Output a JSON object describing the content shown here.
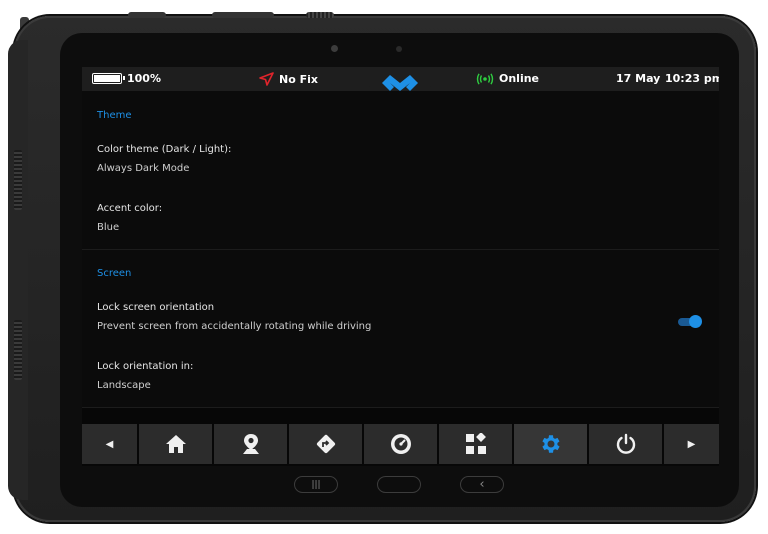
{
  "status_bar": {
    "battery_percent_label": "100%",
    "battery_level": 1.0,
    "gps_label": "No Fix",
    "connection_label": "Online",
    "date": "17 May",
    "time": "10:23 pm",
    "colors": {
      "gps_icon": "#e0242b",
      "online_icon": "#2ecc40"
    }
  },
  "theme_section": {
    "title": "Theme",
    "color_theme_label": "Color theme (Dark / Light):",
    "color_theme_value": "Always Dark Mode",
    "accent_color_label": "Accent color:",
    "accent_color_value": "Blue"
  },
  "screen_section": {
    "title": "Screen",
    "lock_orientation_label": "Lock screen orientation",
    "lock_orientation_description": "Prevent screen from accidentally rotating while driving",
    "lock_orientation_enabled": true,
    "lock_orientation_in_label": "Lock orientation in:",
    "lock_orientation_in_value": "Landscape"
  },
  "nav_bar": {
    "left_arrow": "◀",
    "right_arrow": "▶",
    "items": [
      {
        "icon": "home-icon",
        "active": false
      },
      {
        "icon": "map-pin-icon",
        "active": false
      },
      {
        "icon": "directions-icon",
        "active": false
      },
      {
        "icon": "speedometer-icon",
        "active": false
      },
      {
        "icon": "widgets-icon",
        "active": false
      },
      {
        "icon": "gear-icon",
        "active": true
      },
      {
        "icon": "power-icon",
        "active": false
      }
    ]
  },
  "system_keys": {
    "recents": "|||",
    "back": "‹"
  },
  "colors": {
    "accent": "#1e90e6",
    "background": "#0b0b0b",
    "nav_button": "#2c2c2c"
  }
}
